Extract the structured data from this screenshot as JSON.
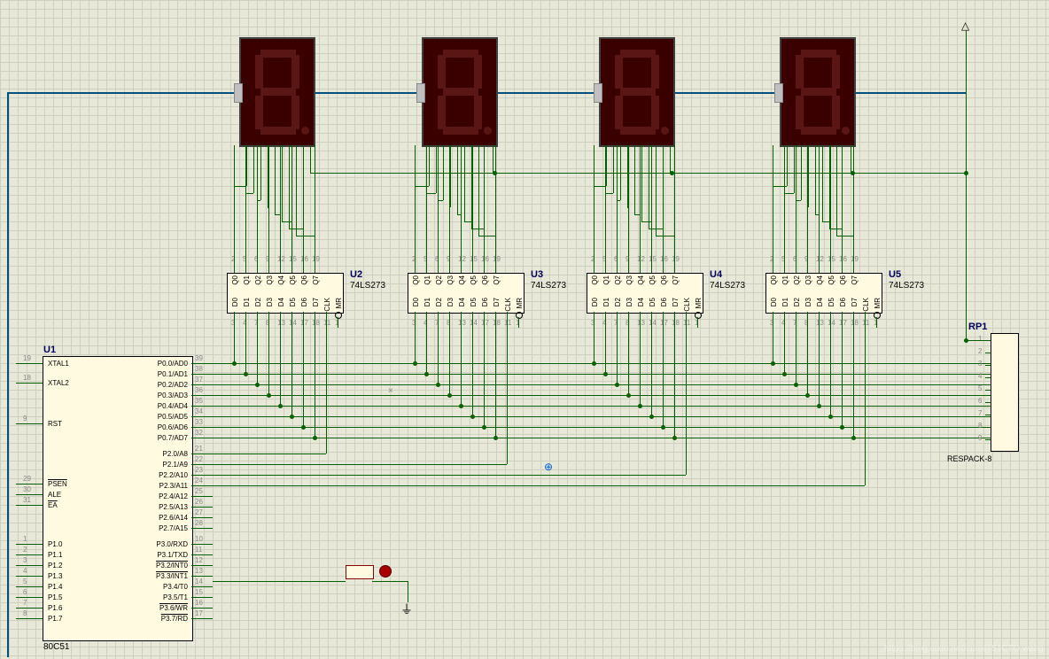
{
  "u1": {
    "name": "U1",
    "part": "80C51",
    "left": [
      {
        "n": "19",
        "t": "XTAL1"
      },
      {
        "n": "18",
        "t": "XTAL2"
      },
      {
        "n": "9",
        "t": "RST"
      },
      {
        "n": "29",
        "t": "PSEN",
        "ov": true
      },
      {
        "n": "30",
        "t": "ALE"
      },
      {
        "n": "31",
        "t": "EA",
        "ov": true
      },
      {
        "n": "1",
        "t": "P1.0"
      },
      {
        "n": "2",
        "t": "P1.1"
      },
      {
        "n": "3",
        "t": "P1.2"
      },
      {
        "n": "4",
        "t": "P1.3"
      },
      {
        "n": "5",
        "t": "P1.4"
      },
      {
        "n": "6",
        "t": "P1.5"
      },
      {
        "n": "7",
        "t": "P1.6"
      },
      {
        "n": "8",
        "t": "P1.7"
      }
    ],
    "right": [
      {
        "n": "39",
        "t": "P0.0/AD0"
      },
      {
        "n": "38",
        "t": "P0.1/AD1"
      },
      {
        "n": "37",
        "t": "P0.2/AD2"
      },
      {
        "n": "36",
        "t": "P0.3/AD3"
      },
      {
        "n": "35",
        "t": "P0.4/AD4"
      },
      {
        "n": "34",
        "t": "P0.5/AD5"
      },
      {
        "n": "33",
        "t": "P0.6/AD6"
      },
      {
        "n": "32",
        "t": "P0.7/AD7"
      },
      {
        "n": "21",
        "t": "P2.0/A8"
      },
      {
        "n": "22",
        "t": "P2.1/A9"
      },
      {
        "n": "23",
        "t": "P2.2/A10"
      },
      {
        "n": "24",
        "t": "P2.3/A11"
      },
      {
        "n": "25",
        "t": "P2.4/A12"
      },
      {
        "n": "26",
        "t": "P2.5/A13"
      },
      {
        "n": "27",
        "t": "P2.6/A14"
      },
      {
        "n": "28",
        "t": "P2.7/A15"
      },
      {
        "n": "10",
        "t": "P3.0/RXD"
      },
      {
        "n": "11",
        "t": "P3.1/TXD"
      },
      {
        "n": "12",
        "t": "P3.2/INT0",
        "ov": true
      },
      {
        "n": "13",
        "t": "P3.3/INT1",
        "ov": true
      },
      {
        "n": "14",
        "t": "P3.4/T0"
      },
      {
        "n": "15",
        "t": "P3.5/T1"
      },
      {
        "n": "16",
        "t": "P3.6/WR",
        "ov": true
      },
      {
        "n": "17",
        "t": "P3.7/RD",
        "ov": true
      }
    ]
  },
  "latch": {
    "part": "74LS273",
    "names": [
      "U2",
      "U3",
      "U4",
      "U5"
    ],
    "top_q": [
      "Q0",
      "Q1",
      "Q2",
      "Q3",
      "Q4",
      "Q5",
      "Q6",
      "Q7"
    ],
    "top_n": [
      "2",
      "5",
      "6",
      "9",
      "12",
      "15",
      "16",
      "19"
    ],
    "bot_d": [
      "D0",
      "D1",
      "D2",
      "D3",
      "D4",
      "D5",
      "D6",
      "D7",
      "CLK",
      "MR"
    ],
    "bot_n": [
      "3",
      "4",
      "7",
      "8",
      "13",
      "14",
      "17",
      "18",
      "11",
      "1"
    ]
  },
  "rp1": {
    "name": "RP1",
    "part": "RESPACK-8",
    "pins": [
      "1",
      "2",
      "3",
      "4",
      "5",
      "6",
      "7",
      "8",
      "9"
    ]
  },
  "watermark": "https://blog.csdn.net/cum@51CTO.wang"
}
